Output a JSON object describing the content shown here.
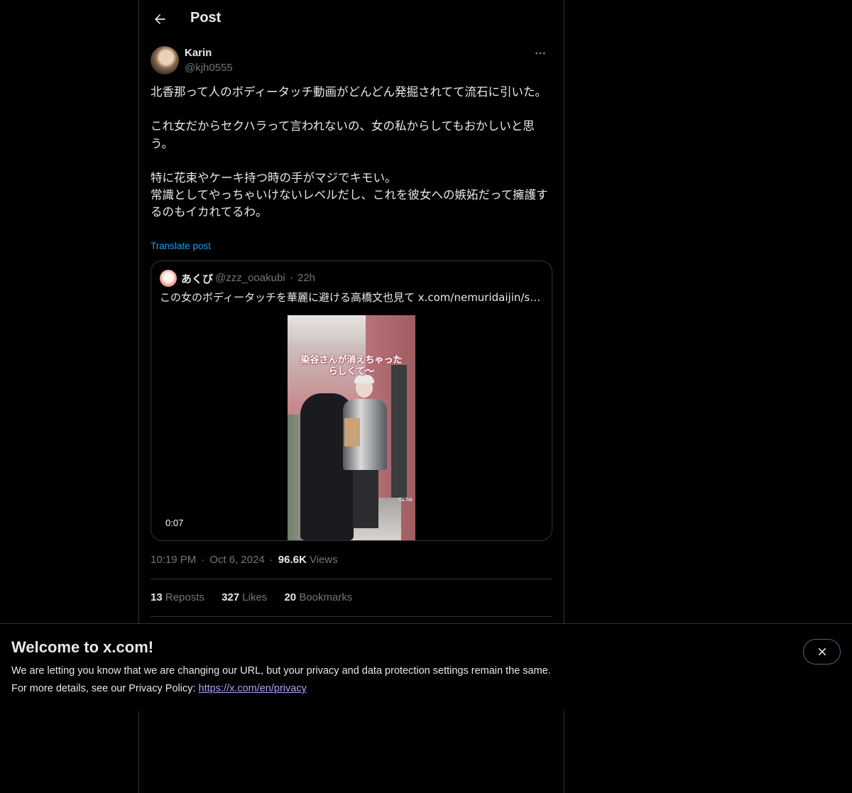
{
  "header": {
    "title": "Post"
  },
  "post": {
    "author_name": "Karin",
    "author_handle": "@kjh0555",
    "text": "北香那って人のボディータッチ動画がどんどん発掘されてて流石に引いた。\n\nこれ女だからセクハラって言われないの、女の私からしてもおかしいと思う。\n\n特に花束やケーキ持つ時の手がマジでキモい。\n常識としてやっちゃいけないレベルだし、これを彼女への嫉妬だって擁護するのもイカれてるわ。",
    "translate_label": "Translate post",
    "time": "10:19 PM",
    "date": "Oct 6, 2024",
    "views_count": "96.6K",
    "views_label": "Views"
  },
  "quote": {
    "name": "あくび",
    "handle": "@zzz_ooakubi",
    "separator": "·",
    "time": "22h",
    "text": "この女のボディータッチを華麗に避ける高橋文也見て  x.com/nemuridaijin/s…",
    "video": {
      "caption": "染谷さんが消えちゃった\nらしくて〜",
      "watermark": "TikTok",
      "duration": "0:07"
    }
  },
  "stats": {
    "reposts_count": "13",
    "reposts_label": "Reposts",
    "likes_count": "327",
    "likes_label": "Likes",
    "bookmarks_count": "20",
    "bookmarks_label": "Bookmarks"
  },
  "banner": {
    "title": "Welcome to x.com!",
    "line1": "We are letting you know that we are changing our URL, but your privacy and data protection settings remain the same.",
    "line2_prefix": "For more details, see our Privacy Policy: ",
    "privacy_link": "https://x.com/en/privacy"
  },
  "icons": {
    "back": "arrow-left-icon",
    "more": "more-horizontal-icon",
    "close": "close-icon"
  },
  "colors": {
    "background": "#000000",
    "text_primary": "#e7e9ea",
    "text_secondary": "#71767b",
    "accent": "#1d9bf0",
    "border": "#2f3336",
    "link_visited": "#a8a4f7"
  }
}
